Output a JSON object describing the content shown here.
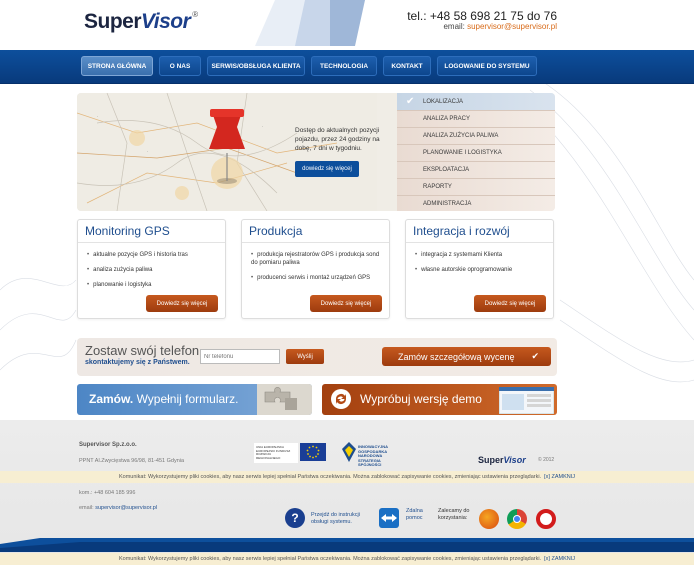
{
  "header": {
    "logo_super": "Super",
    "logo_visor": "Visor",
    "logo_reg": "®",
    "phone": "tel.: +48 58 698 21 75 do 76",
    "email_label": "email:",
    "email": "supervisor@supervisor.pl"
  },
  "nav": {
    "items": [
      {
        "label": "STRONA GŁÓWNA",
        "active": true
      },
      {
        "label": "O NAS"
      },
      {
        "label": "SERWIS/OBSŁUGA KLIENTA"
      },
      {
        "label": "TECHNOLOGIA"
      },
      {
        "label": "KONTAKT"
      },
      {
        "label": "LOGOWANIE DO SYSTEMU"
      }
    ]
  },
  "hero": {
    "text": "Dostęp do aktualnych pozycji pojazdu, przez 24 godziny na dobę, 7 dni w tygodniu.",
    "button": "dowiedz się więcej",
    "menu": [
      "LOKALIZACJA",
      "ANALIZA PRACY",
      "ANALIZA ZUŻYCIA PALIWA",
      "PLANOWANIE I LOGISTYKA",
      "EKSPLOATACJA",
      "RAPORTY",
      "ADMINISTRACJA"
    ]
  },
  "cards": [
    {
      "title": "Monitoring GPS",
      "items": [
        "aktualne pozycje GPS i historia tras",
        "analiza zużycia paliwa",
        "planowanie i logistyka"
      ],
      "button": "Dowiedz się więcej"
    },
    {
      "title": "Produkcja",
      "items": [
        "produkcja rejestratorów GPS i produkcja sond do pomiaru paliwa",
        "producenci serwis i montaż urządzeń GPS"
      ],
      "button": "Dowiedz się więcej"
    },
    {
      "title": "Integracja i rozwój",
      "items": [
        "integracja z systemami Klienta",
        "własne autorskie oprogramowanie"
      ],
      "button": "Dowiedz się więcej"
    }
  ],
  "callback": {
    "title": "Zostaw swój telefon",
    "subtitle": "skontaktujemy się z Państwem.",
    "placeholder": "Nr telefonu",
    "send": "Wyślij",
    "order": "Zamów szczegółową wycenę",
    "order_check": "✔"
  },
  "banners": {
    "form_bold": "Zamów.",
    "form_rest": " Wypełnij formularz.",
    "demo": "Wypróbuj wersję demo"
  },
  "footer": {
    "company": "Supervisor Sp.z.o.o.",
    "address": "PPNT Al.Zwycięstwa 96/98, 81-451 Gdynia",
    "phone": "kom.: +48 604 185 996",
    "email_label": "email:",
    "email": "supervisor@supervisor.pl",
    "eu_text": "UNIA EUROPEJSKA EUROPEJSKI FUNDUSZ ROZWOJU REGIONALNEGO",
    "ig_text": "INNOWACYJNA GOSPODARKA NARODOWA STRATEGIA SPÓJNOŚCI",
    "logo_super": "Super",
    "logo_visor": "Visor",
    "year": "© 2012",
    "help": "Przejdź do instrukcji obsługi systemu.",
    "teamviewer": "Zdalna pomoc",
    "recommend": "Zalecamy do korzystania:"
  },
  "cookie": {
    "text": "Komunikat: Wykorzystujemy pliki cookies, aby nasz serwis lepiej spełniał Państwa oczekiwania. Można zablokować zapisywanie cookies, zmieniając ustawienia przeglądarki.",
    "close": "[x] ZAMKNIJ"
  },
  "colors": {
    "nav_blue": "#0d4f9c",
    "accent_orange": "#c6591e",
    "title_blue": "#1f4e8e"
  }
}
